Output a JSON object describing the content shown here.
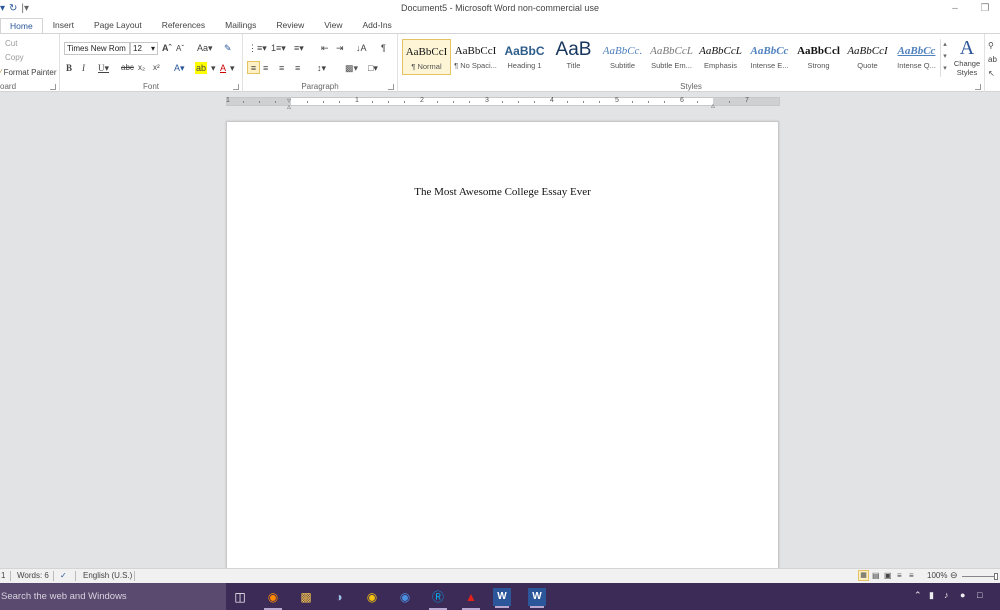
{
  "window": {
    "title": "Document5 - Microsoft Word non-commercial use"
  },
  "quick_access": {
    "undo_icon": "undo-icon",
    "redo_icon": "redo-icon"
  },
  "tabs": [
    {
      "label": "Home",
      "active": true
    },
    {
      "label": "Insert"
    },
    {
      "label": "Page Layout"
    },
    {
      "label": "References"
    },
    {
      "label": "Mailings"
    },
    {
      "label": "Review"
    },
    {
      "label": "View"
    },
    {
      "label": "Add-Ins"
    }
  ],
  "ribbon": {
    "clipboard": {
      "cut": "Cut",
      "copy": "Copy",
      "format_painter": "Format Painter",
      "label": "oard"
    },
    "font": {
      "name": "Times New Rom",
      "size": "12",
      "label": "Font"
    },
    "paragraph": {
      "label": "Paragraph"
    },
    "styles": {
      "label": "Styles",
      "items": [
        {
          "sample": "AaBbCcI",
          "name": "¶ Normal"
        },
        {
          "sample": "AaBbCcI",
          "name": "¶ No Spaci..."
        },
        {
          "sample": "AaBbC",
          "name": "Heading 1"
        },
        {
          "sample": "AaB",
          "name": "Title"
        },
        {
          "sample": "AaBbCc.",
          "name": "Subtitle"
        },
        {
          "sample": "AaBbCcL",
          "name": "Subtle Em..."
        },
        {
          "sample": "AaBbCcL",
          "name": "Emphasis"
        },
        {
          "sample": "AaBbCc",
          "name": "Intense E..."
        },
        {
          "sample": "AaBbCcl",
          "name": "Strong"
        },
        {
          "sample": "AaBbCcI",
          "name": "Quote"
        },
        {
          "sample": "AaBbCc",
          "name": "Intense Q..."
        }
      ],
      "change_styles": "Change Styles"
    }
  },
  "ruler": {
    "numbers": [
      "1",
      "1",
      "2",
      "3",
      "4",
      "5",
      "6",
      "7"
    ]
  },
  "document": {
    "title": "The Most Awesome College Essay Ever"
  },
  "statusbar": {
    "page": "1",
    "words": "Words: 6",
    "language": "English (U.S.)",
    "zoom": "100%"
  },
  "taskbar": {
    "search_placeholder": "Search the web and Windows"
  },
  "colors": {
    "accent": "#2b579a",
    "taskbar": "#3c2a57",
    "selected_style_border": "#e5c365"
  }
}
